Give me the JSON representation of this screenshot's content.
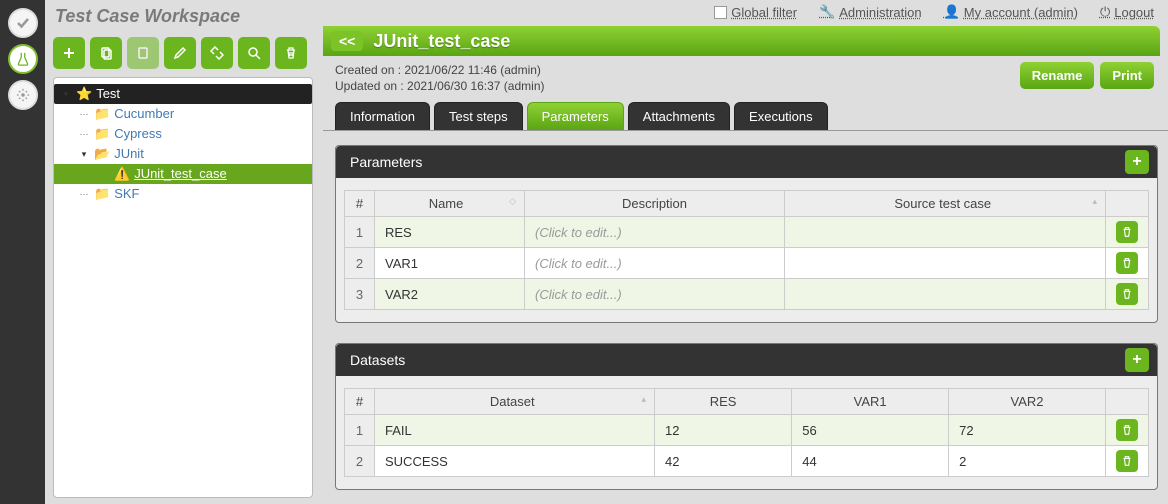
{
  "workspace_title": "Test Case Workspace",
  "topbar": {
    "global_filter": "Global filter",
    "administration": "Administration",
    "my_account": "My account (admin)",
    "logout": "Logout"
  },
  "page": {
    "title": "JUnit_test_case",
    "created": "Created on :  2021/06/22 11:46 (admin)",
    "updated": "Updated on :  2021/06/30 16:37 (admin)"
  },
  "buttons": {
    "rename": "Rename",
    "print": "Print"
  },
  "tree": {
    "root": "Test",
    "nodes": [
      "Cucumber",
      "Cypress",
      "JUnit",
      "SKF"
    ],
    "junit_child": "JUnit_test_case"
  },
  "tabs": [
    "Information",
    "Test steps",
    "Parameters",
    "Attachments",
    "Executions"
  ],
  "panels": {
    "parameters": "Parameters",
    "datasets": "Datasets"
  },
  "param_table": {
    "headers": {
      "num": "#",
      "name": "Name",
      "desc": "Description",
      "source": "Source test case"
    },
    "click_edit": "(Click to edit...)",
    "rows": [
      {
        "n": "1",
        "name": "RES"
      },
      {
        "n": "2",
        "name": "VAR1"
      },
      {
        "n": "3",
        "name": "VAR2"
      }
    ]
  },
  "ds_table": {
    "headers": {
      "num": "#",
      "ds": "Dataset",
      "c1": "RES",
      "c2": "VAR1",
      "c3": "VAR2"
    },
    "rows": [
      {
        "n": "1",
        "ds": "FAIL",
        "c1": "12",
        "c2": "56",
        "c3": "72"
      },
      {
        "n": "2",
        "ds": "SUCCESS",
        "c1": "42",
        "c2": "44",
        "c3": "2"
      }
    ]
  }
}
